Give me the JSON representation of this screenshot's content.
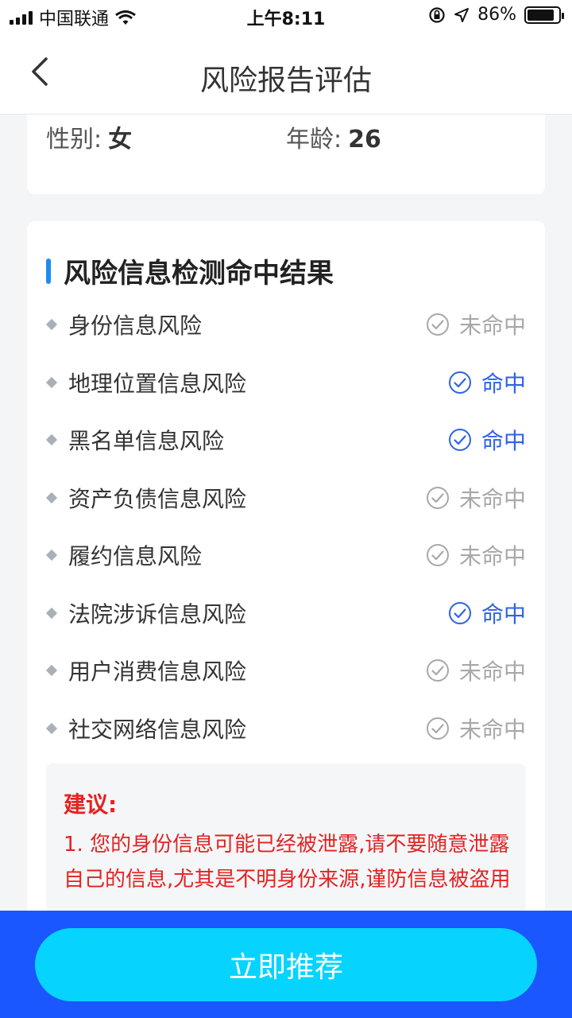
{
  "status_bar": {
    "carrier": "中国联通",
    "time": "上午8:11",
    "battery": "86%",
    "battery_level": 0.86
  },
  "nav": {
    "title": "风险报告评估",
    "back_icon": "chevron-left-icon"
  },
  "basic_info": {
    "gender_label": "性别:",
    "gender_value": "女",
    "age_label": "年龄:",
    "age_value": "26"
  },
  "risk": {
    "title": "风险信息检测命中结果",
    "items": [
      {
        "label": "身份信息风险",
        "status": "未命中",
        "hit": false
      },
      {
        "label": "地理位置信息风险",
        "status": "命中",
        "hit": true
      },
      {
        "label": "黑名单信息风险",
        "status": "命中",
        "hit": true
      },
      {
        "label": "资产负债信息风险",
        "status": "未命中",
        "hit": false
      },
      {
        "label": "履约信息风险",
        "status": "未命中",
        "hit": false
      },
      {
        "label": "法院涉诉信息风险",
        "status": "命中",
        "hit": true
      },
      {
        "label": "用户消费信息风险",
        "status": "未命中",
        "hit": false
      },
      {
        "label": "社交网络信息风险",
        "status": "未命中",
        "hit": false
      }
    ]
  },
  "advice": {
    "title": "建议:",
    "text": "1. 您的身份信息可能已经被泄露,请不要随意泄露自己的信息,尤其是不明身份来源,谨防信息被盗用"
  },
  "bottom": {
    "button_label": "立即推荐"
  },
  "colors": {
    "accent": "#1f8bf0",
    "hit": "#2f62e6",
    "miss": "#a8a8a8",
    "advice": "#e42222",
    "bottom_bar": "#1a57ff",
    "button": "#06d4ff"
  }
}
